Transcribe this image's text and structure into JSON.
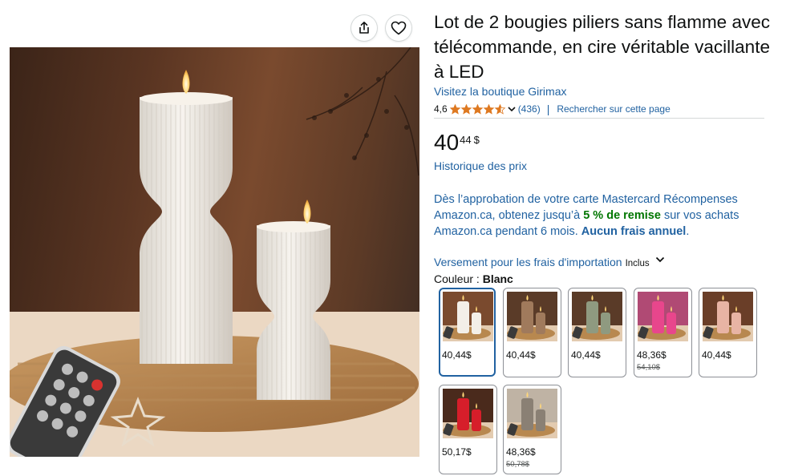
{
  "product": {
    "title": "Lot de 2 bougies piliers sans flamme avec télécommande, en cire véritable vacillante à LED",
    "store_link": "Visitez la boutique Girimax",
    "rating_value": "4,6",
    "rating_count": "(436)",
    "search_page": "Rechercher sur cette page",
    "price_whole": "40",
    "price_fraction": "44",
    "price_currency": "$",
    "price_history": "Historique des prix"
  },
  "promo": {
    "part1": "Dès l’approbation de votre carte Mastercard Récompenses Amazon.ca, obtenez jusqu’à ",
    "highlight": "5 % de remise",
    "part2": " sur vos achats Amazon.ca pendant 6 mois. ",
    "bold": "Aucun frais annuel",
    "part3": "."
  },
  "import": {
    "link": "Versement pour les frais d'importation",
    "included": "Inclus"
  },
  "color": {
    "label": "Couleur :",
    "selected": "Blanc"
  },
  "swatches": [
    {
      "price": "40,44$",
      "old_price": "",
      "bg": "#7a4a2e",
      "c1": "#f3efe8",
      "c2": "#f3efe8"
    },
    {
      "price": "40,44$",
      "old_price": "",
      "bg": "#5a3b28",
      "c1": "#a07a5c",
      "c2": "#a07a5c"
    },
    {
      "price": "40,44$",
      "old_price": "",
      "bg": "#5a3b28",
      "c1": "#8f9a80",
      "c2": "#8f9a80"
    },
    {
      "price": "48,36$",
      "old_price": "54,10$",
      "bg": "#b04a74",
      "c1": "#e8468c",
      "c2": "#e8468c"
    },
    {
      "price": "40,44$",
      "old_price": "",
      "bg": "#6a3e28",
      "c1": "#e8b4a4",
      "c2": "#e8b4a4"
    },
    {
      "price": "50,17$",
      "old_price": "",
      "bg": "#4a2a1c",
      "c1": "#d61e2a",
      "c2": "#d61e2a"
    },
    {
      "price": "48,36$",
      "old_price": "50,78$",
      "bg": "#bfb3a4",
      "c1": "#8a8074",
      "c2": "#8a8074"
    }
  ],
  "colors": {
    "link": "#2162a1",
    "promo_green": "#007600",
    "star": "#de7921",
    "selected_border": "#2162a1"
  }
}
